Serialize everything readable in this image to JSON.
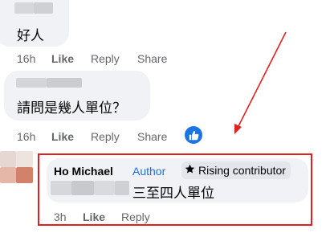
{
  "comments": [
    {
      "text": "好人",
      "actions": {
        "time": "16h",
        "like": "Like",
        "reply": "Reply",
        "share": "Share"
      }
    },
    {
      "text": "請問是幾人單位？",
      "actions": {
        "time": "16h",
        "like": "Like",
        "reply": "Reply",
        "share": "Share"
      },
      "reaction_icon": "like-thumb-icon"
    }
  ],
  "reply": {
    "author_name": "Ho Michael",
    "author_tag": "Author",
    "badge_label": "Rising contributor",
    "badge_icon": "rising-star-icon",
    "text": "三至四人單位",
    "actions": {
      "time": "3h",
      "like": "Like",
      "reply": "Reply"
    }
  },
  "colors": {
    "bubble": "#f0f2f5",
    "highlight_border": "#e0211d",
    "arrow": "#e0211d",
    "author_tag": "#216fdb",
    "like_reaction": "#1b74e4"
  }
}
